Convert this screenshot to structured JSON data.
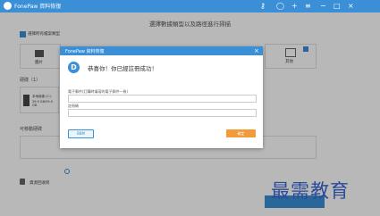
{
  "app": {
    "name": "FonePaw 資料恢復"
  },
  "background": {
    "heading": "選擇數據類型以及路徑進行掃描",
    "select_all_label": "選擇所有檔案類型",
    "category_image": "圖片",
    "category_other": "其他",
    "drives_label": "硬碟（1）",
    "drive_name": "本地磁碟 (C:)",
    "drive_size": "39.9 GB/59.9 GB",
    "removable_label": "可移動硬碟",
    "recycle_label": "資源回收筒"
  },
  "modal": {
    "title": "FonePaw 資料恢復",
    "close": "×",
    "message": "恭喜你！你已經註冊成功！",
    "email_label": "電子郵件(訂購時填寫的電子郵件一致)",
    "code_label": "註冊碼",
    "left_button": "BBM",
    "right_button": "確定"
  },
  "watermark": "最需教育"
}
